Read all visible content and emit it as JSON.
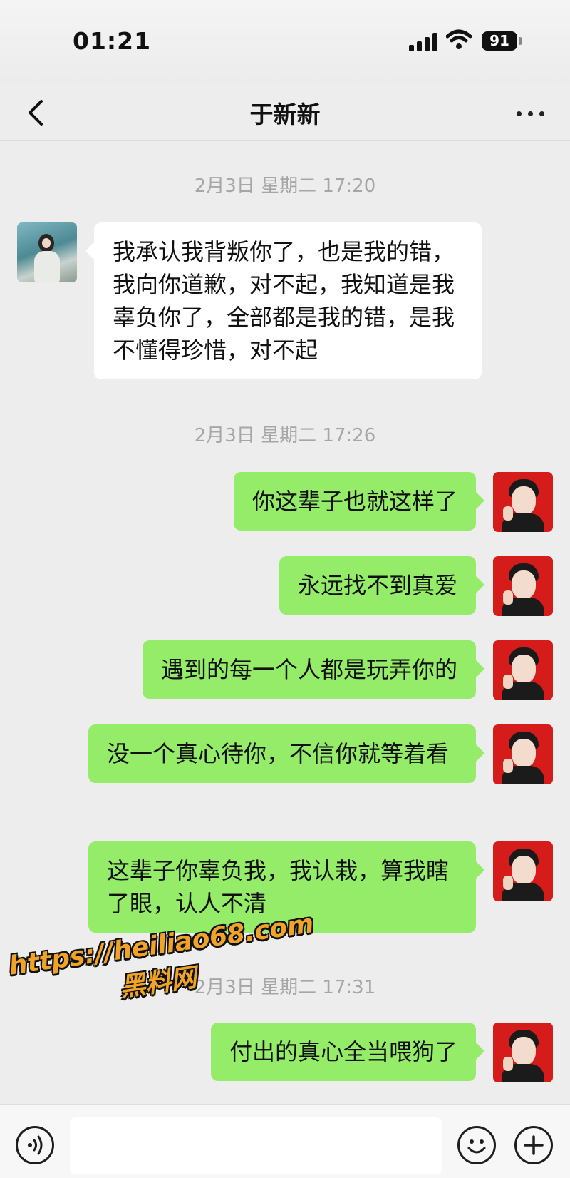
{
  "status_bar": {
    "time": "01:21",
    "battery": "91"
  },
  "header": {
    "title": "于新新"
  },
  "messages": [
    {
      "timestamp": "2月3日 星期二 17:20"
    },
    {
      "sender": "contact",
      "text": "我承认我背叛你了，也是我的错，我向你道歉，对不起，我知道是我辜负你了，全部都是我的错，是我不懂得珍惜，对不起"
    },
    {
      "timestamp": "2月3日 星期二 17:26"
    },
    {
      "sender": "me",
      "text": "你这辈子也就这样了"
    },
    {
      "sender": "me",
      "text": "永远找不到真爱"
    },
    {
      "sender": "me",
      "text": "遇到的每一个人都是玩弄你的"
    },
    {
      "sender": "me",
      "text": "没一个真心待你，不信你就等着看"
    },
    {
      "sender": "me",
      "text": "这辈子你辜负我，我认栽，算我瞎了眼，认人不清"
    },
    {
      "timestamp": "2月3日 星期二 17:31"
    },
    {
      "sender": "me",
      "text": "付出的真心全当喂狗了"
    }
  ],
  "watermark": {
    "url": "https://heiliao68.com",
    "name": "黑料网"
  },
  "icons": {
    "back": "chevron-left-icon",
    "more": "more-dots-icon",
    "voice": "voice-icon",
    "emoji": "emoji-icon",
    "plus": "plus-icon"
  },
  "colors": {
    "background": "#ededed",
    "outgoing_bubble": "#95ec69",
    "incoming_bubble": "#ffffff",
    "timestamp": "#a6a6a6"
  }
}
